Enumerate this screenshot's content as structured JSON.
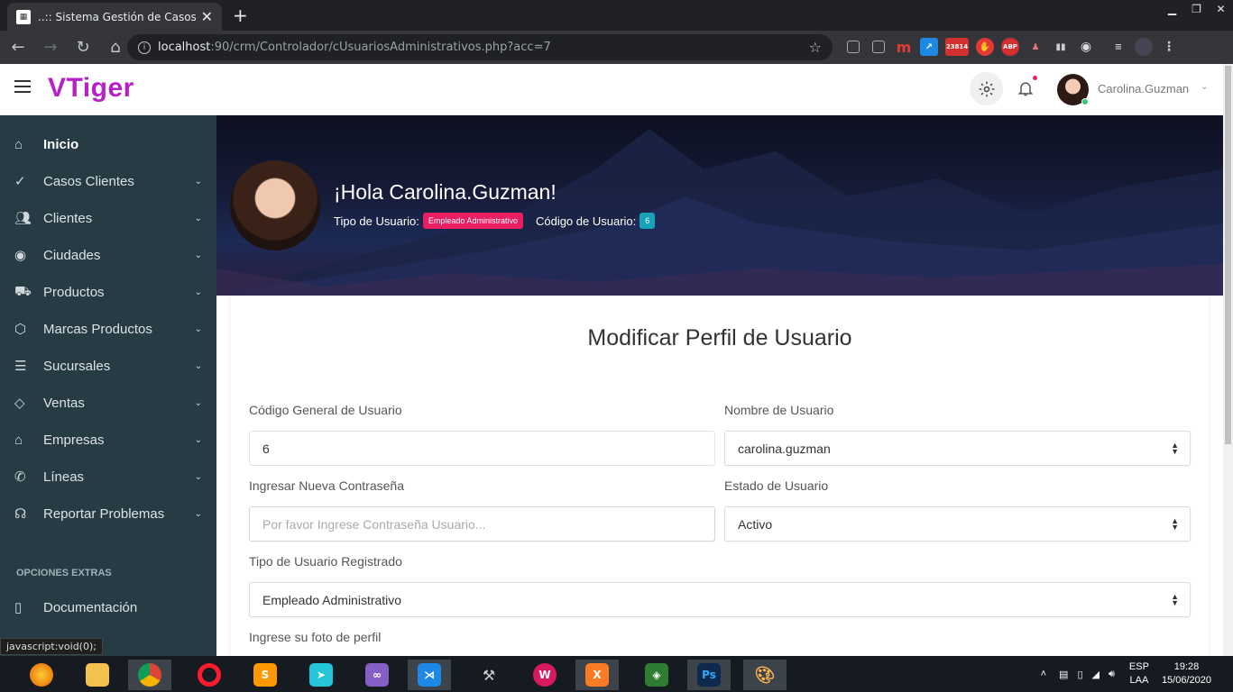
{
  "browser": {
    "tab_title": "..:: Sistema Gestión de Casos vtiger",
    "url_host": "localhost",
    "url_rest": ":90/crm/Controlador/cUsuariosAdministrativos.php?acc=7",
    "ext_badge": "23814",
    "status": "javascript:void(0);"
  },
  "header": {
    "logo": "VTiger",
    "username": "Carolina.Guzman"
  },
  "sidebar": {
    "items": [
      {
        "label": "Inicio",
        "icon": "home-icon"
      },
      {
        "label": "Casos Clientes",
        "icon": "check-circle-icon"
      },
      {
        "label": "Clientes",
        "icon": "users-icon"
      },
      {
        "label": "Ciudades",
        "icon": "map-pin-icon"
      },
      {
        "label": "Productos",
        "icon": "cart-icon"
      },
      {
        "label": "Marcas Productos",
        "icon": "box-icon"
      },
      {
        "label": "Sucursales",
        "icon": "layers-icon"
      },
      {
        "label": "Ventas",
        "icon": "tag-icon"
      },
      {
        "label": "Empresas",
        "icon": "home-icon"
      },
      {
        "label": "Líneas",
        "icon": "phone-icon"
      },
      {
        "label": "Reportar Problemas",
        "icon": "headphones-icon"
      }
    ],
    "extras_caption": "OPCIONES EXTRAS",
    "doc_label": "Documentación"
  },
  "hero": {
    "greeting": "¡Hola Carolina.Guzman!",
    "tipo_label": "Tipo de Usuario:",
    "tipo_value": "Empleado Administrativo",
    "codigo_label": "Código de Usuario:",
    "codigo_value": "6"
  },
  "form": {
    "title": "Modificar Perfil de Usuario",
    "codigo_label": "Código General de Usuario",
    "codigo_value": "6",
    "nombre_label": "Nombre de Usuario",
    "nombre_value": "carolina.guzman",
    "pass_label": "Ingresar Nueva Contraseña",
    "pass_placeholder": "Por favor Ingrese Contraseña Usuario...",
    "estado_label": "Estado de Usuario",
    "estado_value": "Activo",
    "tipo_label": "Tipo de Usuario Registrado",
    "tipo_value": "Empleado Administrativo",
    "foto_label": "Ingrese su foto de perfil"
  },
  "taskbar": {
    "lang1": "ESP",
    "lang2": "LAA",
    "time": "19:28",
    "date": "15/06/2020"
  },
  "colors": {
    "brand": "#b620c6",
    "sidebar": "#273b44",
    "badge_pink": "#e91e63",
    "badge_cyan": "#17a2b8"
  }
}
